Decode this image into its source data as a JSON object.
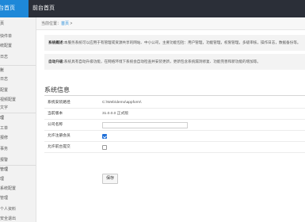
{
  "topbar": {
    "brand": "台首页",
    "nav_home": "前台首页"
  },
  "sidebar": {
    "rows": [
      "页",
      "快件单",
      "统配置",
      "日志",
      "账",
      "日志",
      "配置",
      "视频配置",
      "文字",
      "理",
      "工单",
      "报修",
      "事务",
      "报警",
      "管理",
      "理",
      "系统配置",
      "管理",
      "个人资料",
      "安全退出"
    ]
  },
  "breadcrumb": {
    "prefix": "当前位置：",
    "home": "首页",
    "separator": ">"
  },
  "notices": [
    {
      "label": "系统概述:",
      "text": "本服务系统可以应用于有管理或资源共享的网站、中小公司，主要功能包括：用户管理，功能管理，权限管理，多级审核，操作日志，数据备份等。"
    },
    {
      "label": "自动升级:",
      "text": "系统具有自动升级功能，在网络环境下系统会自动检查并安装更新，更新包含系统漏洞修复、功能完善和新功能的增加等。"
    }
  ],
  "section": {
    "title": "系统信息"
  },
  "form": {
    "install_dir_label": "系统安装路径",
    "install_dir_value": "C:\\Web\\demo\\appform\\",
    "version_label": "当前版本",
    "version_value": "31.0.0.0 正式版",
    "company_label": "公司名称",
    "company_value": "",
    "allow_reg_label": "允许注册会员",
    "allow_reg_checked": true,
    "allow_front_label": "允许前台提交",
    "allow_front_checked": false,
    "save_label": "保存"
  },
  "colors": {
    "topbar": "#2b2f38",
    "accent": "#1e88d8",
    "sidebar": "#f2f2f2"
  }
}
